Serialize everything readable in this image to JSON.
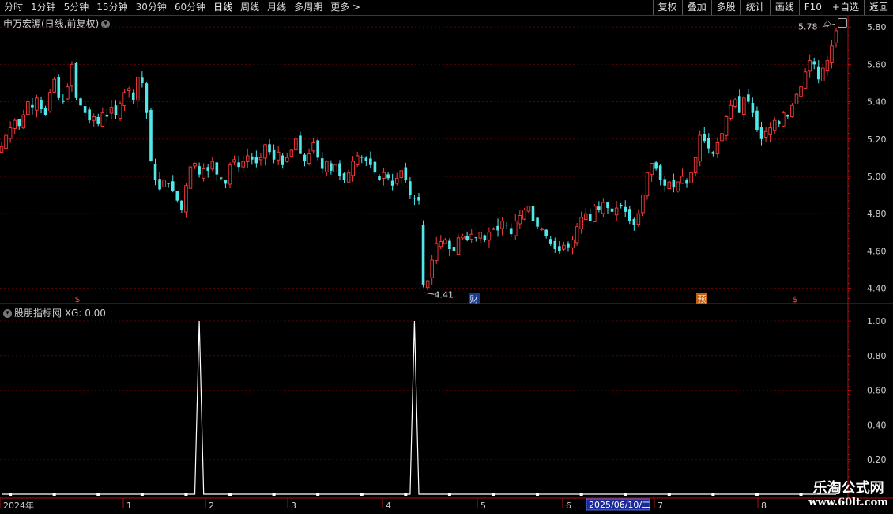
{
  "toolbar": {
    "periods": [
      "分时",
      "1分钟",
      "5分钟",
      "15分钟",
      "30分钟",
      "60分钟",
      "日线",
      "周线",
      "月线",
      "多周期",
      "更多 >"
    ],
    "active_period": "日线",
    "actions": [
      "复权",
      "叠加",
      "多股",
      "统计",
      "画线",
      "F10",
      "+自选",
      "返回"
    ]
  },
  "main_panel": {
    "title": "申万宏源(日线,前复权)",
    "price_axis": [
      "5.80",
      "5.60",
      "5.40",
      "5.20",
      "5.00",
      "4.80",
      "4.60",
      "4.40"
    ],
    "high_label": "5.78",
    "low_label": "4.41",
    "markers": [
      "$",
      "财",
      "预",
      "$"
    ]
  },
  "indicator_panel": {
    "title": "股朋指标网 XG: 0.00",
    "axis": [
      "1.00",
      "0.80",
      "0.60",
      "0.40",
      "0.20"
    ]
  },
  "date_axis": {
    "labels": [
      "2024年",
      "1",
      "2",
      "3",
      "4",
      "5",
      "6",
      "2025/06/10/二",
      "7",
      "8"
    ]
  },
  "watermark": {
    "line1": "乐淘公式网",
    "line2": "www.60lt.com"
  },
  "colors": {
    "up": "#ff3b3b",
    "down": "#52e8ea",
    "axis": "#b01010",
    "grid": "#5a0000"
  },
  "chart_data": {
    "type": "candlestick",
    "price_range": [
      4.36,
      5.86
    ],
    "closes": [
      5.16,
      5.22,
      5.26,
      5.3,
      5.27,
      5.33,
      5.4,
      5.37,
      5.42,
      5.36,
      5.33,
      5.45,
      5.52,
      5.42,
      5.4,
      5.48,
      5.6,
      5.42,
      5.38,
      5.34,
      5.3,
      5.32,
      5.28,
      5.34,
      5.32,
      5.37,
      5.33,
      5.39,
      5.45,
      5.47,
      5.41,
      5.53,
      5.5,
      5.34,
      5.08,
      4.98,
      4.93,
      4.98,
      4.96,
      4.92,
      4.87,
      4.82,
      4.95,
      5.05,
      5.07,
      5.01,
      5.04,
      5.03,
      5.08,
      5.01,
      4.99,
      4.96,
      5.06,
      5.09,
      5.05,
      5.08,
      5.11,
      5.09,
      5.07,
      5.1,
      5.17,
      5.13,
      5.09,
      5.13,
      5.06,
      5.1,
      5.14,
      5.2,
      5.12,
      5.08,
      5.12,
      5.18,
      5.1,
      5.04,
      5.08,
      5.03,
      5.06,
      5.0,
      4.98,
      5.02,
      5.08,
      5.11,
      5.1,
      5.08,
      5.06,
      5.02,
      4.98,
      5.02,
      4.99,
      4.95,
      4.99,
      5.03,
      4.98,
      4.9,
      4.88,
      4.87,
      4.42,
      4.44,
      4.55,
      4.64,
      4.65,
      4.66,
      4.61,
      4.6,
      4.67,
      4.68,
      4.66,
      4.69,
      4.67,
      4.7,
      4.66,
      4.7,
      4.72,
      4.71,
      4.76,
      4.74,
      4.69,
      4.76,
      4.79,
      4.82,
      4.84,
      4.76,
      4.73,
      4.72,
      4.68,
      4.64,
      4.61,
      4.6,
      4.63,
      4.62,
      4.66,
      4.73,
      4.78,
      4.8,
      4.76,
      4.84,
      4.82,
      4.86,
      4.83,
      4.81,
      4.83,
      4.84,
      4.81,
      4.76,
      4.74,
      4.8,
      4.9,
      5.02,
      5.07,
      5.04,
      4.98,
      4.95,
      4.97,
      4.94,
      4.97,
      5.0,
      4.96,
      5.02,
      5.1,
      5.22,
      5.19,
      5.15,
      5.12,
      5.18,
      5.23,
      5.32,
      5.38,
      5.41,
      5.34,
      5.42,
      5.4,
      5.34,
      5.25,
      5.2,
      5.24,
      5.26,
      5.3,
      5.28,
      5.34,
      5.32,
      5.38,
      5.44,
      5.48,
      5.56,
      5.62,
      5.6,
      5.52,
      5.58,
      5.62,
      5.7,
      5.78
    ],
    "xg": {
      "spikes_at_index": [
        45,
        94
      ],
      "value_range": [
        0,
        1
      ]
    }
  }
}
